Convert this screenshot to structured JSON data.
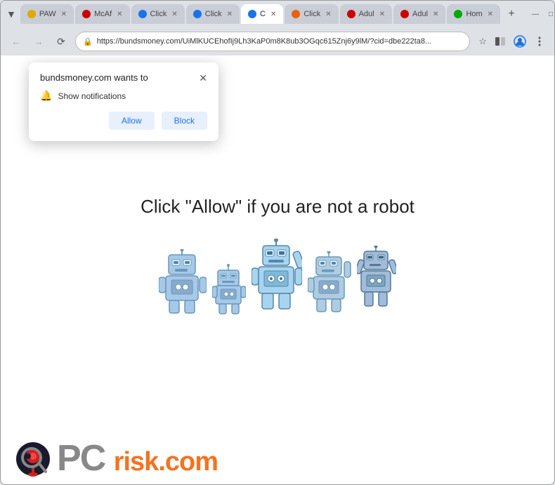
{
  "window": {
    "title": "Click"
  },
  "tabs": [
    {
      "id": "tab1",
      "label": "PAW",
      "active": false,
      "favicon_color": "#e0a800"
    },
    {
      "id": "tab2",
      "label": "McAf",
      "active": false,
      "favicon_color": "#c00"
    },
    {
      "id": "tab3",
      "label": "Click",
      "active": false,
      "favicon_color": "#1a73e8"
    },
    {
      "id": "tab4",
      "label": "Click",
      "active": false,
      "favicon_color": "#1a73e8"
    },
    {
      "id": "tab5",
      "label": "C",
      "active": true,
      "favicon_color": "#1a73e8"
    },
    {
      "id": "tab6",
      "label": "Click",
      "active": false,
      "favicon_color": "#e8610c"
    },
    {
      "id": "tab7",
      "label": "Adul",
      "active": false,
      "favicon_color": "#c00"
    },
    {
      "id": "tab8",
      "label": "Adul",
      "active": false,
      "favicon_color": "#c00"
    },
    {
      "id": "tab9",
      "label": "Hom",
      "active": false,
      "favicon_color": "#00a800"
    }
  ],
  "address_bar": {
    "url": "https://bundsmoney.com/UiMlKUCEhofIj9Lh3KaP0m8K8ub3OGqc615Znj6y9lM/?cid=dbe222ta8...",
    "secure_icon": "🔒"
  },
  "notification_popup": {
    "title": "bundsmoney.com wants to",
    "notification_label": "Show notifications",
    "allow_label": "Allow",
    "block_label": "Block"
  },
  "page": {
    "headline": "Click \"Allow\"  if you are not  a robot"
  },
  "pcrisk": {
    "pc_text": "PC",
    "risk_text": "risk.com"
  },
  "window_controls": {
    "minimize": "—",
    "maximize": "□",
    "close": "✕"
  }
}
